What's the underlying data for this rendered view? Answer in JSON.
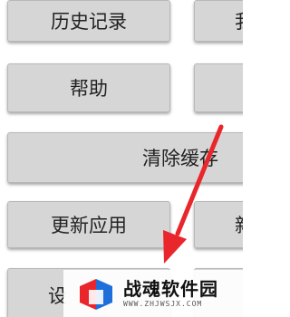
{
  "menu": {
    "history": "历史记录",
    "right_top": "我",
    "help": "帮助",
    "right_help": "",
    "clear_cache": "清除缓存",
    "update_app": "更新应用",
    "right_update": "新",
    "settings": "设",
    "right_settings": ""
  },
  "annotation": {
    "arrow_color": "#e8262b"
  },
  "watermark": {
    "title": "战魂软件园",
    "url": "WWW.ZHJWSJX.COM",
    "logo_icon": "logo-icon"
  }
}
